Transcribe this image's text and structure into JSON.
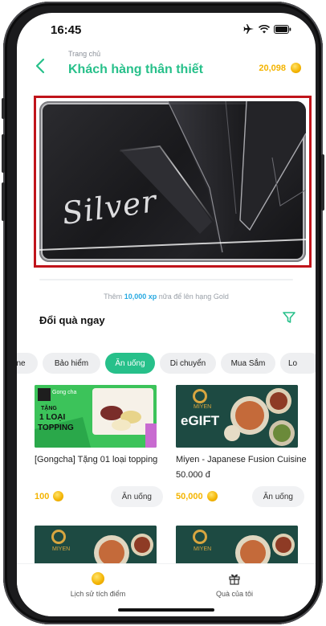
{
  "status_bar": {
    "time": "16:45"
  },
  "header": {
    "breadcrumb": "Trang chủ",
    "title": "Khách hàng thân thiết",
    "points": "20,098"
  },
  "card": {
    "tier_text": "Silver"
  },
  "xp_note": {
    "prefix": "Thêm",
    "amount": "10,000 xp",
    "suffix": "nữa để lên hạng Gold"
  },
  "section": {
    "title": "Đổi quà ngay"
  },
  "chips": [
    {
      "label": "ne"
    },
    {
      "label": "Bảo hiểm"
    },
    {
      "label": "Ăn uống",
      "active": true
    },
    {
      "label": "Di chuyển"
    },
    {
      "label": "Mua Sắm"
    },
    {
      "label": "Lo"
    }
  ],
  "products": [
    {
      "name": "[Gongcha] Tặng 01 loại topping",
      "price": "100",
      "category": "Ăn uống",
      "thumb": {
        "tag": "TẶNG",
        "line1": "1 LOẠI",
        "line2": "TOPPING",
        "brand": "Gong cha"
      }
    },
    {
      "name": "Miyen - Japanese Fusion Cuisine 50.000 đ",
      "price": "50,000",
      "category": "Ăn uống",
      "thumb": {
        "label": "eGIFT",
        "brand": "MIYEN"
      }
    },
    {
      "thumb": {
        "brand": "MIYEN"
      }
    },
    {
      "thumb": {
        "brand": "MIYEN"
      }
    }
  ],
  "bottom_nav": {
    "history_label": "Lịch sử tích điểm",
    "gifts_label": "Quà của tôi"
  },
  "colors": {
    "accent": "#27c08a",
    "coin": "#f4b400",
    "link": "#27a9e1",
    "highlight_border": "#c0141b"
  }
}
